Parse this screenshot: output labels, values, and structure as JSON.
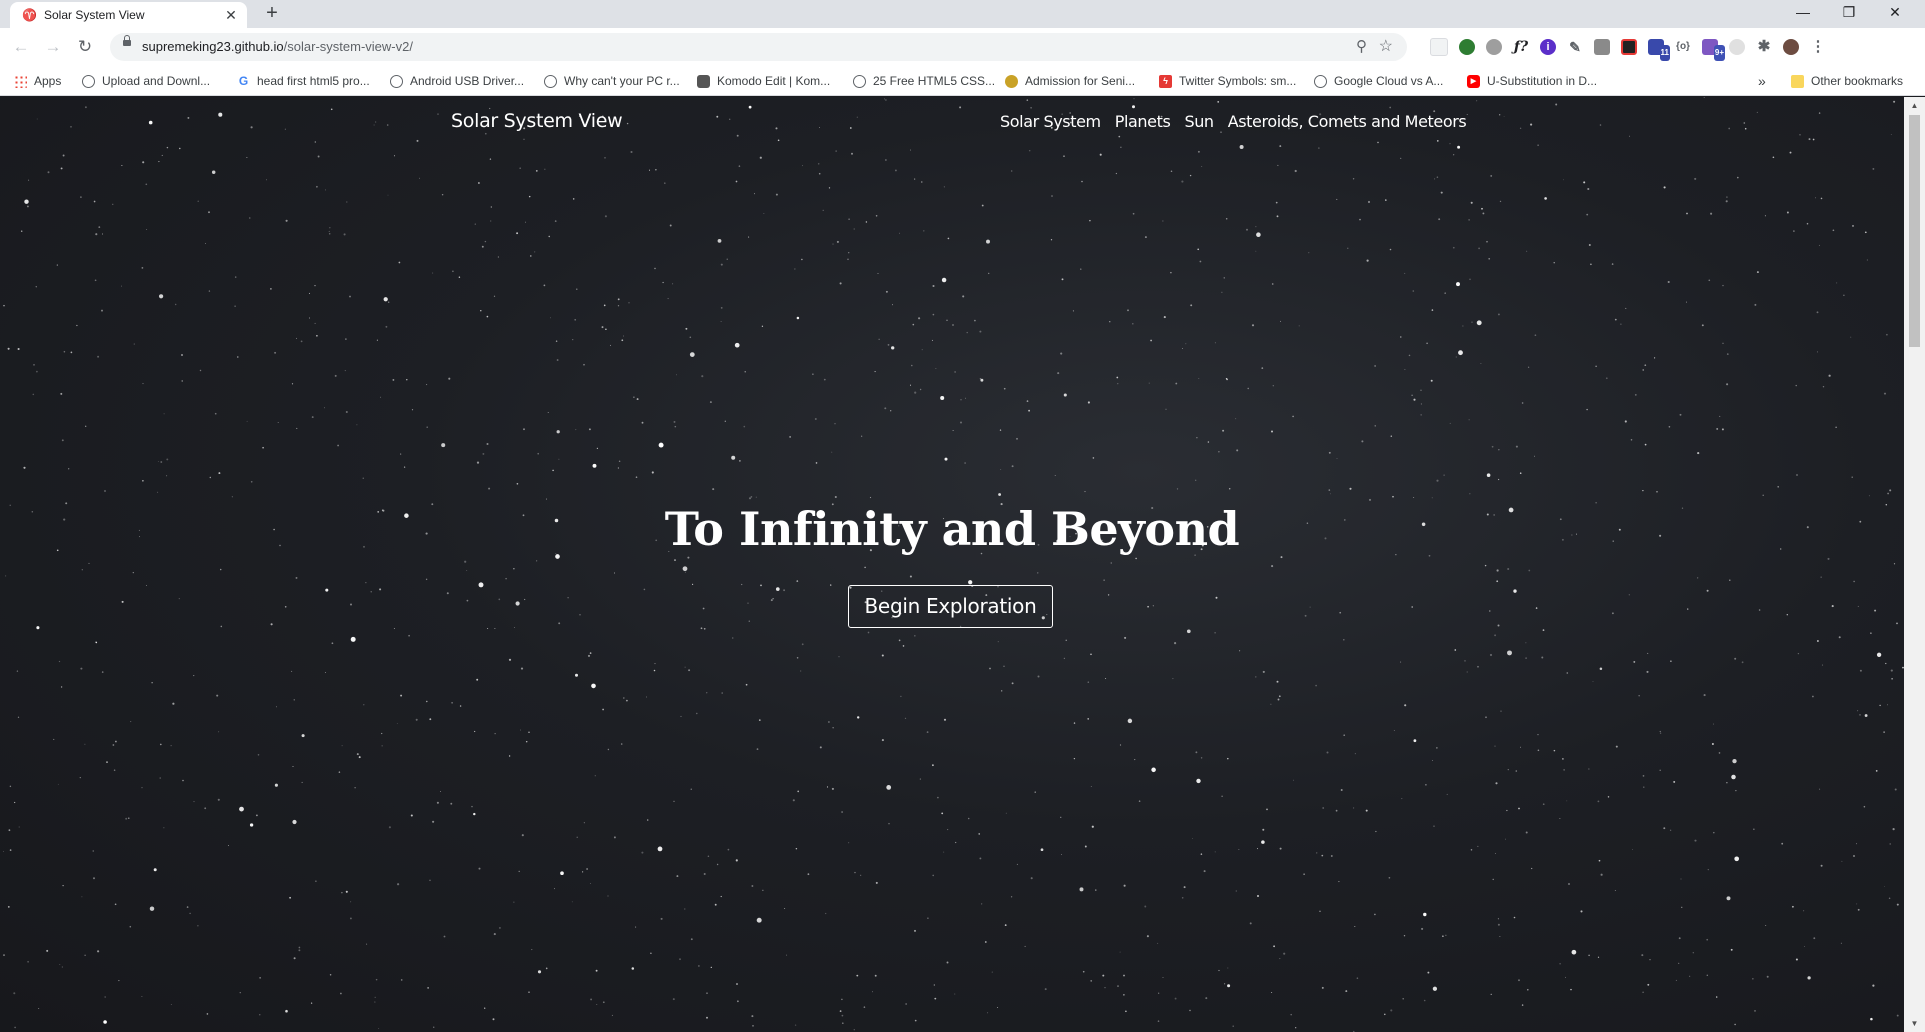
{
  "browser": {
    "tab": {
      "title": "Solar System View",
      "favicon": "page-favicon"
    },
    "new_tab_symbol": "+",
    "window_controls": {
      "minimize": "—",
      "restore": "❐",
      "close": "✕"
    },
    "nav": {
      "back": "←",
      "forward": "→",
      "reload": "↻"
    },
    "address_bar": {
      "domain": "supremeking23.github.io",
      "path": "/solar-system-view-v2/"
    },
    "bookmarks": [
      {
        "label": "Apps",
        "icon": "apps-grid-icon"
      },
      {
        "label": "Upload and Downl...",
        "icon": "globe-icon"
      },
      {
        "label": "head first html5 pro...",
        "icon": "google-icon"
      },
      {
        "label": "Android USB Driver...",
        "icon": "globe-icon"
      },
      {
        "label": "Why can't your PC r...",
        "icon": "globe-icon"
      },
      {
        "label": "Komodo Edit | Kom...",
        "icon": "komodo-icon"
      },
      {
        "label": "25 Free HTML5 CSS...",
        "icon": "globe-icon"
      },
      {
        "label": "Admission for Seni...",
        "icon": "admission-icon"
      },
      {
        "label": "Twitter Symbols: sm...",
        "icon": "flash-icon"
      },
      {
        "label": "Google Cloud vs A...",
        "icon": "globe-icon"
      },
      {
        "label": "U-Substitution in D...",
        "icon": "youtube-icon"
      }
    ],
    "overflow_symbol": "»",
    "other_bookmarks": "Other bookmarks",
    "extension_badges": {
      "calendar": "11",
      "puzzle9": "9+"
    }
  },
  "site": {
    "brand": "Solar System View",
    "nav_links": [
      "Solar System",
      "Planets",
      "Sun",
      "Asteroids, Comets and Meteors"
    ],
    "hero_title": "To Infinity and Beyond",
    "hero_button": "Begin Exploration"
  }
}
